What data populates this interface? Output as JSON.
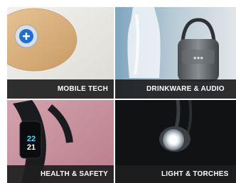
{
  "categories": [
    {
      "label": "MOBILE TECH",
      "icon": "wireless-charger-pad"
    },
    {
      "label": "DRINKWARE & AUDIO",
      "icon": "bluetooth-speaker"
    },
    {
      "label": "HEALTH & SAFETY",
      "icon": "fitness-tracker"
    },
    {
      "label": "LIGHT & TORCHES",
      "icon": "headlamp"
    }
  ],
  "tracker": {
    "time_hours": "22",
    "time_minutes": "21"
  },
  "colors": {
    "label_bar": "#1e1e20",
    "accent_blue": "#1f6fd0",
    "health_bg": "#c58f9b",
    "torch_bg": "#101214"
  }
}
